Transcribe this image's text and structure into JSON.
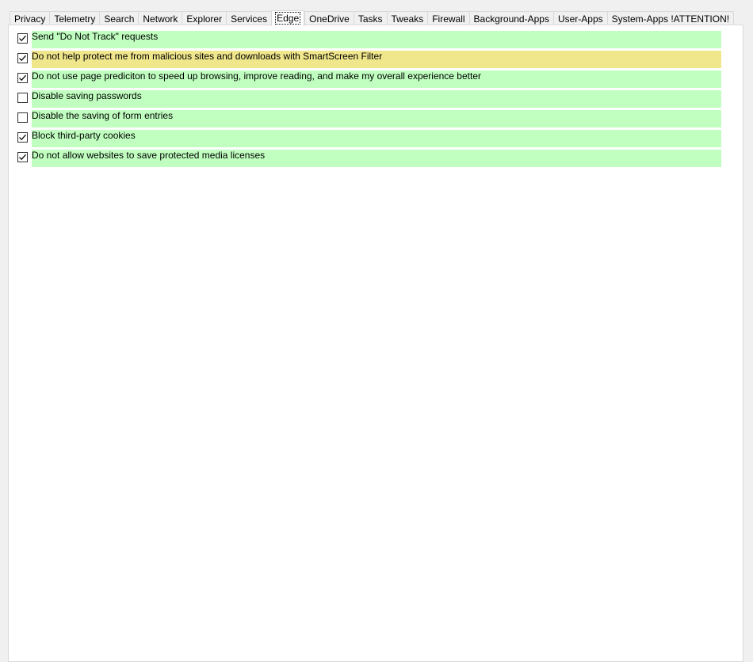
{
  "tabs": [
    {
      "label": "Privacy"
    },
    {
      "label": "Telemetry"
    },
    {
      "label": "Search"
    },
    {
      "label": "Network"
    },
    {
      "label": "Explorer"
    },
    {
      "label": "Services"
    },
    {
      "label": "Edge",
      "selected": true
    },
    {
      "label": "OneDrive"
    },
    {
      "label": "Tasks"
    },
    {
      "label": "Tweaks"
    },
    {
      "label": "Firewall"
    },
    {
      "label": "Background-Apps"
    },
    {
      "label": "User-Apps"
    },
    {
      "label": "System-Apps !ATTENTION!"
    }
  ],
  "colors": {
    "recommended": "#c0ffc0",
    "warning": "#f0e68c"
  },
  "options": [
    {
      "label": "Send \"Do Not Track\" requests",
      "checked": true,
      "status": "recommended"
    },
    {
      "label": "Do not help protect me from malicious sites and downloads with SmartScreen Filter",
      "checked": true,
      "status": "warning"
    },
    {
      "label": "Do not use page prediciton to speed up browsing, improve reading, and make my overall experience better",
      "checked": true,
      "status": "recommended"
    },
    {
      "label": "Disable saving passwords",
      "checked": false,
      "status": "recommended"
    },
    {
      "label": "Disable the saving of form entries",
      "checked": false,
      "status": "recommended"
    },
    {
      "label": "Block third-party cookies",
      "checked": true,
      "status": "recommended"
    },
    {
      "label": "Do not allow websites to save protected media licenses",
      "checked": true,
      "status": "recommended"
    }
  ]
}
